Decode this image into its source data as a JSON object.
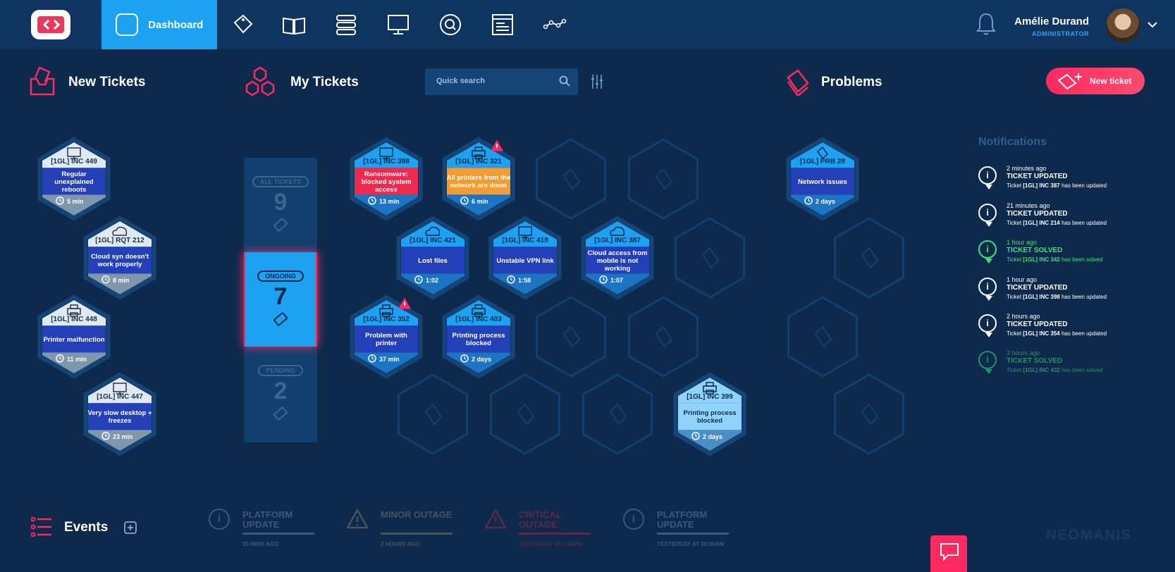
{
  "header": {
    "nav_active_label": "Dashboard",
    "nav_icons": [
      "tag-icon",
      "book-icon",
      "server-icon",
      "monitor-icon",
      "search-q-icon",
      "document-icon",
      "graph-icon"
    ],
    "user_name": "Amélie Durand",
    "user_role": "ADMINISTRATOR"
  },
  "sections": {
    "new_tickets": "New Tickets",
    "my_tickets": "My Tickets",
    "problems": "Problems",
    "events": "Events",
    "notifications": "Notifications"
  },
  "search": {
    "placeholder": "Quick search"
  },
  "new_ticket_button": "New ticket",
  "filters": [
    {
      "label": "ALL TICKETS",
      "count": "9"
    },
    {
      "label": "ONGOING",
      "count": "7"
    },
    {
      "label": "PENDING",
      "count": "2"
    }
  ],
  "new_tickets": [
    {
      "id": "[1GL] INC 449",
      "title": "Regular unexplained reboots",
      "time": "5 min",
      "icon": "monitor-icon"
    },
    {
      "id": "[1GL] RQT 212",
      "title": "Cloud syn doesn't work properly",
      "time": "8 min",
      "icon": "cloud-icon"
    },
    {
      "id": "[1GL] INC 448",
      "title": "Printer malfunction",
      "time": "11 min",
      "icon": "printer-icon"
    },
    {
      "id": "[1GL] INC 447",
      "title": "Very slow desktop + freezes",
      "time": "23 min",
      "icon": "monitor-icon"
    }
  ],
  "my_tickets": [
    {
      "id": "[1GL] INC 398",
      "title": "Ransomware: blocked system access",
      "time": "13 min",
      "icon": "monitor-icon",
      "style": "critical"
    },
    {
      "id": "[1GL] INC 321",
      "title": "All printers from the network are down",
      "time": "6 min",
      "icon": "printer-icon",
      "style": "warning",
      "alert": true
    },
    {
      "id": "[1GL] INC 421",
      "title": "Lost files",
      "time": "1:02",
      "icon": "cloud-icon",
      "style": "normal"
    },
    {
      "id": "[1GL] INC 418",
      "title": "Unstable VPN link",
      "time": "1:58",
      "icon": "desktop-icon",
      "style": "normal"
    },
    {
      "id": "[1GL] INC 387",
      "title": "Cloud access from mobile is not working",
      "time": "1:07",
      "icon": "cloud-icon",
      "style": "normal"
    },
    {
      "id": "[1GL] INC 352",
      "title": "Problem with printer",
      "time": "37 min",
      "icon": "printer-icon",
      "style": "normal",
      "alert": true
    },
    {
      "id": "[1GL] INC 403",
      "title": "Printing process blocked",
      "time": "2 days",
      "icon": "printer-icon",
      "style": "normal"
    },
    {
      "id": "[1GL] INC 399",
      "title": "Printing process blocked",
      "time": "2 days",
      "icon": "printer-icon",
      "style": "pending"
    }
  ],
  "problems": [
    {
      "id": "[1GL] PRB 28",
      "title": "Network issues",
      "time": "2 days",
      "icon": "stack-icon"
    }
  ],
  "notifications": [
    {
      "time": "2 minutes ago",
      "type": "TICKET UPDATED",
      "pre": "Ticket ",
      "ref": "[1GL] INC 387",
      "post": " has been updated",
      "status": "updated"
    },
    {
      "time": "21 minutes ago",
      "type": "TICKET UPDATED",
      "pre": "Ticket ",
      "ref": "[1GL] INC 214",
      "post": " has been updated",
      "status": "updated"
    },
    {
      "time": "1 hour ago",
      "type": "TICKET SOLVED",
      "pre": "Ticket ",
      "ref": "[1GL] INC 342",
      "post": " has been solved",
      "status": "solved"
    },
    {
      "time": "1 hour ago",
      "type": "TICKET UPDATED",
      "pre": "Ticket ",
      "ref": "[1GL] INC 398",
      "post": " has been updated",
      "status": "updated"
    },
    {
      "time": "2 hours ago",
      "type": "TICKET UPDATED",
      "pre": "Ticket ",
      "ref": "[1GL] INC 354",
      "post": " has been updated",
      "status": "updated"
    },
    {
      "time": "3 hours ago",
      "type": "TICKET SOLVED",
      "pre": "Ticket ",
      "ref": "[1GL] INC 432",
      "post": " has been solved",
      "status": "solved"
    }
  ],
  "events": [
    {
      "title": "PLATFORM UPDATE",
      "time": "20 MINS AGO",
      "kind": "info"
    },
    {
      "title": "MINOR OUTAGE",
      "time": "2 HOURS AGO",
      "kind": "minor"
    },
    {
      "title": "CRITICAL OUTAGE",
      "time": "YESTERDAY AT 1:28PM",
      "kind": "critical"
    },
    {
      "title": "PLATFORM UPDATE",
      "time": "YESTERDAY AT 05:00AM",
      "kind": "info"
    }
  ],
  "brand": "NEOMANIS",
  "colors": {
    "background": "#0d2a4c",
    "accent": "#1da1f2",
    "alert": "#ff2a62",
    "warning": "#f39c34",
    "solved": "#3fe07a"
  }
}
